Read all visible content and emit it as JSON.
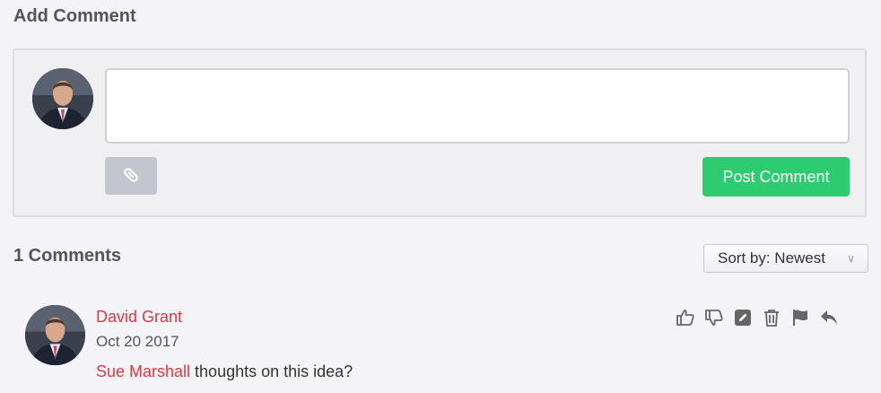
{
  "add_comment": {
    "title": "Add Comment",
    "input_value": "",
    "attach_icon": "paperclip-icon",
    "post_label": "Post Comment"
  },
  "comments_header": {
    "count_label": "1 Comments",
    "sort_label": "Sort by: Newest"
  },
  "comments": [
    {
      "author": "David Grant",
      "date": "Oct 20 2017",
      "mention": "Sue Marshall",
      "text": " thoughts on this idea?",
      "actions": [
        "thumbs-up-icon",
        "thumbs-down-icon",
        "edit-icon",
        "trash-icon",
        "flag-icon",
        "reply-icon"
      ]
    }
  ],
  "colors": {
    "accent_green": "#2ecc71",
    "link_red": "#e0393e",
    "page_bg": "#f4f4f8"
  }
}
